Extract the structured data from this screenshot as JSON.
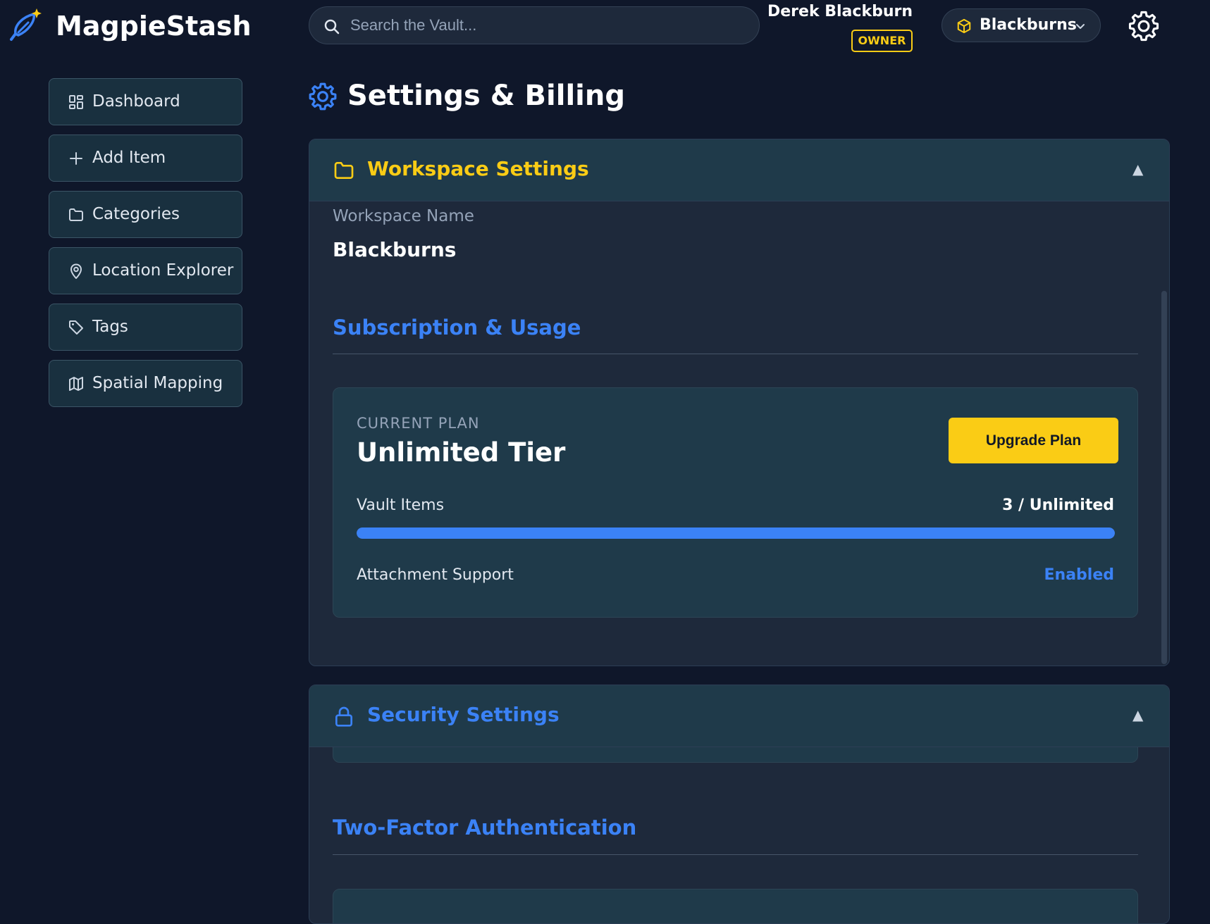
{
  "app": {
    "name": "MagpieStash"
  },
  "header": {
    "search_placeholder": "Search the Vault...",
    "user_name": "Derek Blackburn",
    "role_badge": "OWNER",
    "workspace_switcher_label": "Blackburns"
  },
  "sidebar": {
    "items": [
      {
        "label": "Dashboard",
        "icon": "dashboard-grid-icon"
      },
      {
        "label": "Add Item",
        "icon": "plus-icon"
      },
      {
        "label": "Categories",
        "icon": "folder-icon"
      },
      {
        "label": "Location Explorer",
        "icon": "map-pin-icon"
      },
      {
        "label": "Tags",
        "icon": "tag-icon"
      },
      {
        "label": "Spatial Mapping",
        "icon": "map-icon"
      }
    ]
  },
  "page": {
    "title": "Settings & Billing"
  },
  "workspace_settings": {
    "title": "Workspace Settings",
    "name_label": "Workspace Name",
    "name_value": "Blackburns",
    "subscription_title": "Subscription & Usage",
    "plan_caption": "CURRENT PLAN",
    "plan_name": "Unlimited Tier",
    "upgrade_label": "Upgrade Plan",
    "vault_items_label": "Vault Items",
    "vault_items_value": "3 / Unlimited",
    "vault_items_progress": 1.0,
    "attachment_label": "Attachment Support",
    "attachment_value": "Enabled"
  },
  "security_settings": {
    "title": "Security Settings",
    "two_factor_title": "Two-Factor Authentication"
  },
  "colors": {
    "background": "#0f172a",
    "accent_blue": "#3b82f6",
    "accent_yellow": "#facc15",
    "card_header": "#1f3a4a"
  }
}
